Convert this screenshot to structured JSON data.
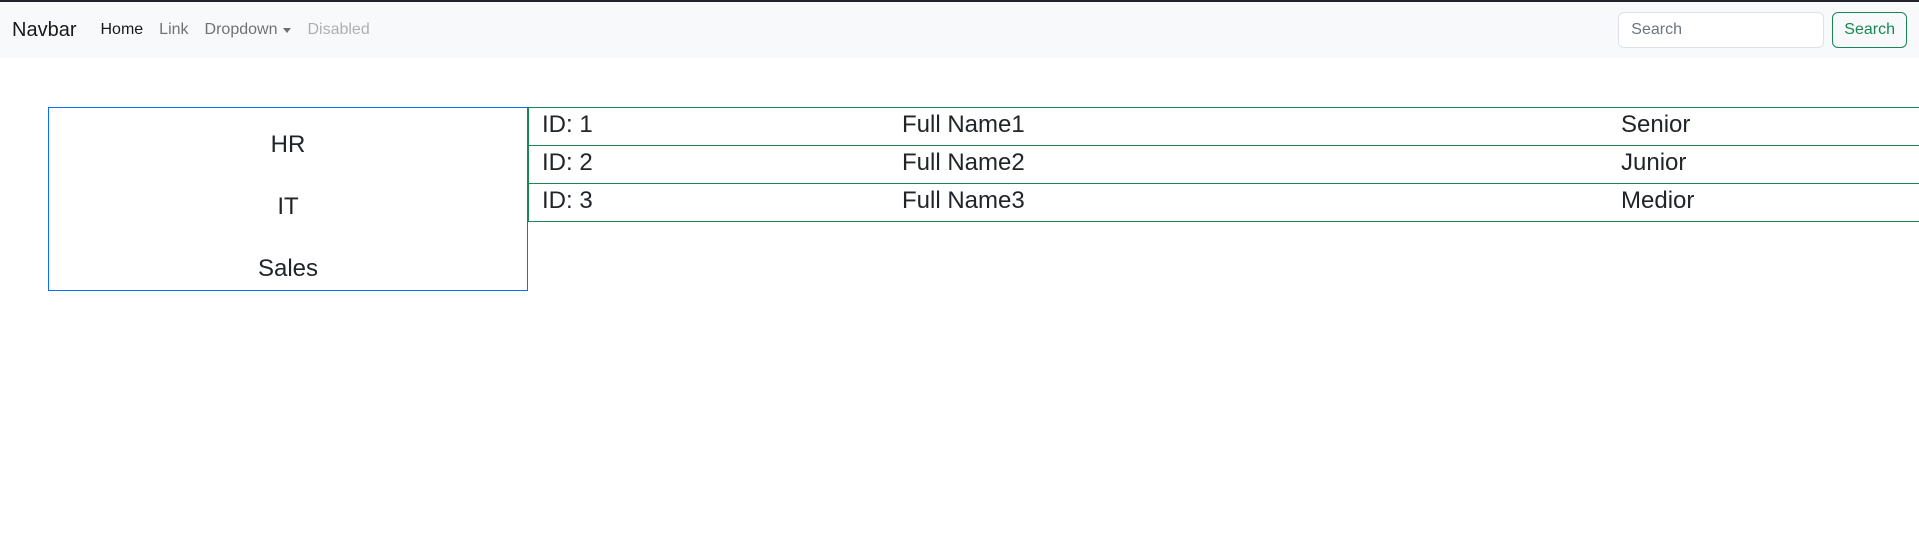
{
  "navbar": {
    "brand": "Navbar",
    "items": [
      {
        "label": "Home",
        "state": "active"
      },
      {
        "label": "Link",
        "state": "normal"
      },
      {
        "label": "Dropdown",
        "state": "dropdown"
      },
      {
        "label": "Disabled",
        "state": "disabled"
      }
    ],
    "search": {
      "placeholder": "Search",
      "value": "",
      "button_label": "Search"
    }
  },
  "departments": [
    "HR",
    "IT",
    "Sales"
  ],
  "employees": [
    {
      "id": "ID: 1",
      "name": "Full Name1",
      "level": "Senior"
    },
    {
      "id": "ID: 2",
      "name": "Full Name2",
      "level": "Junior"
    },
    {
      "id": "ID: 3",
      "name": "Full Name3",
      "level": "Medior"
    }
  ],
  "colors": {
    "dept_border": "#0d6efd",
    "employee_border": "#198754",
    "search_button": "#198754",
    "navbar_bg": "#f8f9fa"
  }
}
